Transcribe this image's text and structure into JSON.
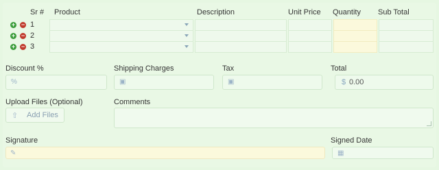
{
  "table": {
    "headers": {
      "sr": "Sr #",
      "product": "Product",
      "description": "Description",
      "unit_price": "Unit Price",
      "quantity": "Quantity",
      "sub_total": "Sub Total"
    },
    "rows": [
      {
        "sr": "1"
      },
      {
        "sr": "2"
      },
      {
        "sr": "3"
      }
    ]
  },
  "fields": {
    "discount_label": "Discount %",
    "shipping_label": "Shipping Charges",
    "tax_label": "Tax",
    "total_label": "Total",
    "total_currency": "$",
    "total_value": "0.00",
    "upload_label": "Upload Files (Optional)",
    "add_files_label": "Add Files",
    "comments_label": "Comments",
    "signature_label": "Signature",
    "signed_date_label": "Signed Date"
  },
  "icons": {
    "add_row": "plus-circle-icon",
    "remove_row": "minus-circle-icon",
    "percent": "percent-icon",
    "money": "money-icon",
    "upload": "upload-icon",
    "pencil": "pencil-icon",
    "calendar": "calendar-icon"
  },
  "colors": {
    "background": "#e6f7e2",
    "add_button": "#3a9c3a",
    "remove_button": "#c0392b",
    "highlight_yellow": "#fbf9dc"
  }
}
